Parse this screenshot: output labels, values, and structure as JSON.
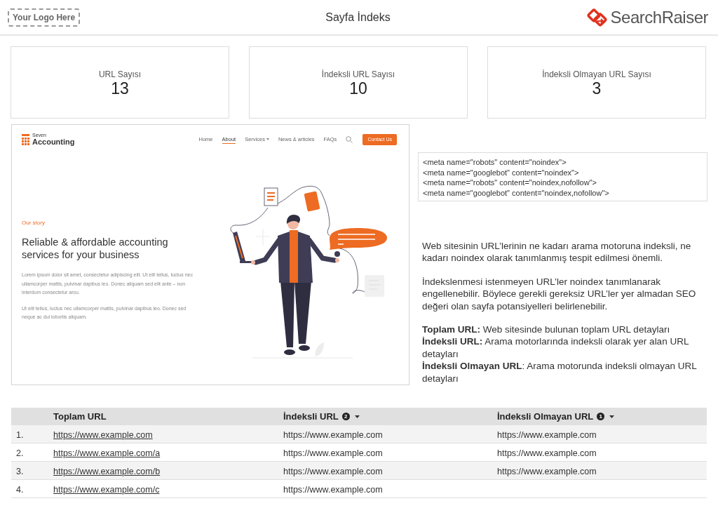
{
  "header": {
    "logo_placeholder": "Your Logo Here",
    "title": "Sayfa İndeks",
    "brand": "SearchRaiser"
  },
  "kpis": [
    {
      "label": "URL Sayısı",
      "value": "13"
    },
    {
      "label": "İndeksli URL Sayısı",
      "value": "10"
    },
    {
      "label": "İndeksli Olmayan URL Sayısı",
      "value": "3"
    }
  ],
  "website_preview": {
    "logo_small": "Seven",
    "logo_large": "Accounting",
    "nav": [
      {
        "label": "Home",
        "selected": false,
        "has_menu": false
      },
      {
        "label": "About",
        "selected": true,
        "has_menu": false
      },
      {
        "label": "Services",
        "selected": false,
        "has_menu": true
      },
      {
        "label": "News & articles",
        "selected": false,
        "has_menu": false
      },
      {
        "label": "FAQs",
        "selected": false,
        "has_menu": false
      }
    ],
    "button": "Contact Us",
    "eyebrow": "Our story",
    "heading": "Reliable & affordable accounting services for your business",
    "paragraphs": [
      "Lorem ipsum dolor sit amet, consectetur adipiscing elit. Ut elit tellus, luctus nec ullamcorper mattis, pulvinar dapibus leo. Donec aliquam sed elit ante – non interdum consectetur arcu.",
      "Ut elit tellus, luctus nec ullamcorper mattis, pulvinar dapibus leo. Donec sed neque ac dui lobortis aliquam."
    ]
  },
  "code_box": {
    "lines": [
      "<meta name=\"robots\" content=\"noindex\">",
      "<meta name=\"googlebot\" content=\"noindex\">",
      "<meta name=\"robots\" content=\"noindex,nofollow\">",
      "<meta name=\"googlebot\" content=\"noindex,nofollow\">"
    ]
  },
  "description": {
    "paragraphs": [
      "Web sitesinin URL’lerinin ne kadarı arama motoruna indeksli, ne kadarı noindex olarak tanımlanmış tespit edilmesi önemli.",
      "İndekslenmesi istenmeyen URL’ler noindex tanımlanarak engellenebilir. Böylece gerekli gereksiz URL’ler yer almadan SEO değeri olan sayfa potansiyelleri belirlenebilir."
    ],
    "definitions": [
      "**Toplam URL:** Web sitesinde bulunan toplam URL detayları",
      "**İndeksli URL:** Arama motorlarında indeksli olarak yer alan URL detayları",
      "**İndeksli Olmayan URL**: Arama motorunda indeksli olmayan URL detayları"
    ]
  },
  "table": {
    "columns": [
      {
        "label": "Toplam URL"
      },
      {
        "label": "İndeksli URL",
        "sort_order": "2"
      },
      {
        "label": "İndeksli Olmayan URL",
        "sort_order": "1"
      }
    ],
    "rows": [
      {
        "number": "1.",
        "cells": [
          "https://www.example.com",
          "https://www.example.com",
          "https://www.example.com"
        ]
      },
      {
        "number": "2.",
        "cells": [
          "https://www.example.com/a",
          "https://www.example.com",
          "https://www.example.com"
        ]
      },
      {
        "number": "3.",
        "cells": [
          "https://www.example.com/b",
          "https://www.example.com",
          "https://www.example.com"
        ]
      },
      {
        "number": "4.",
        "cells": [
          "https://www.example.com/c",
          "https://www.example.com"
        ]
      }
    ]
  }
}
